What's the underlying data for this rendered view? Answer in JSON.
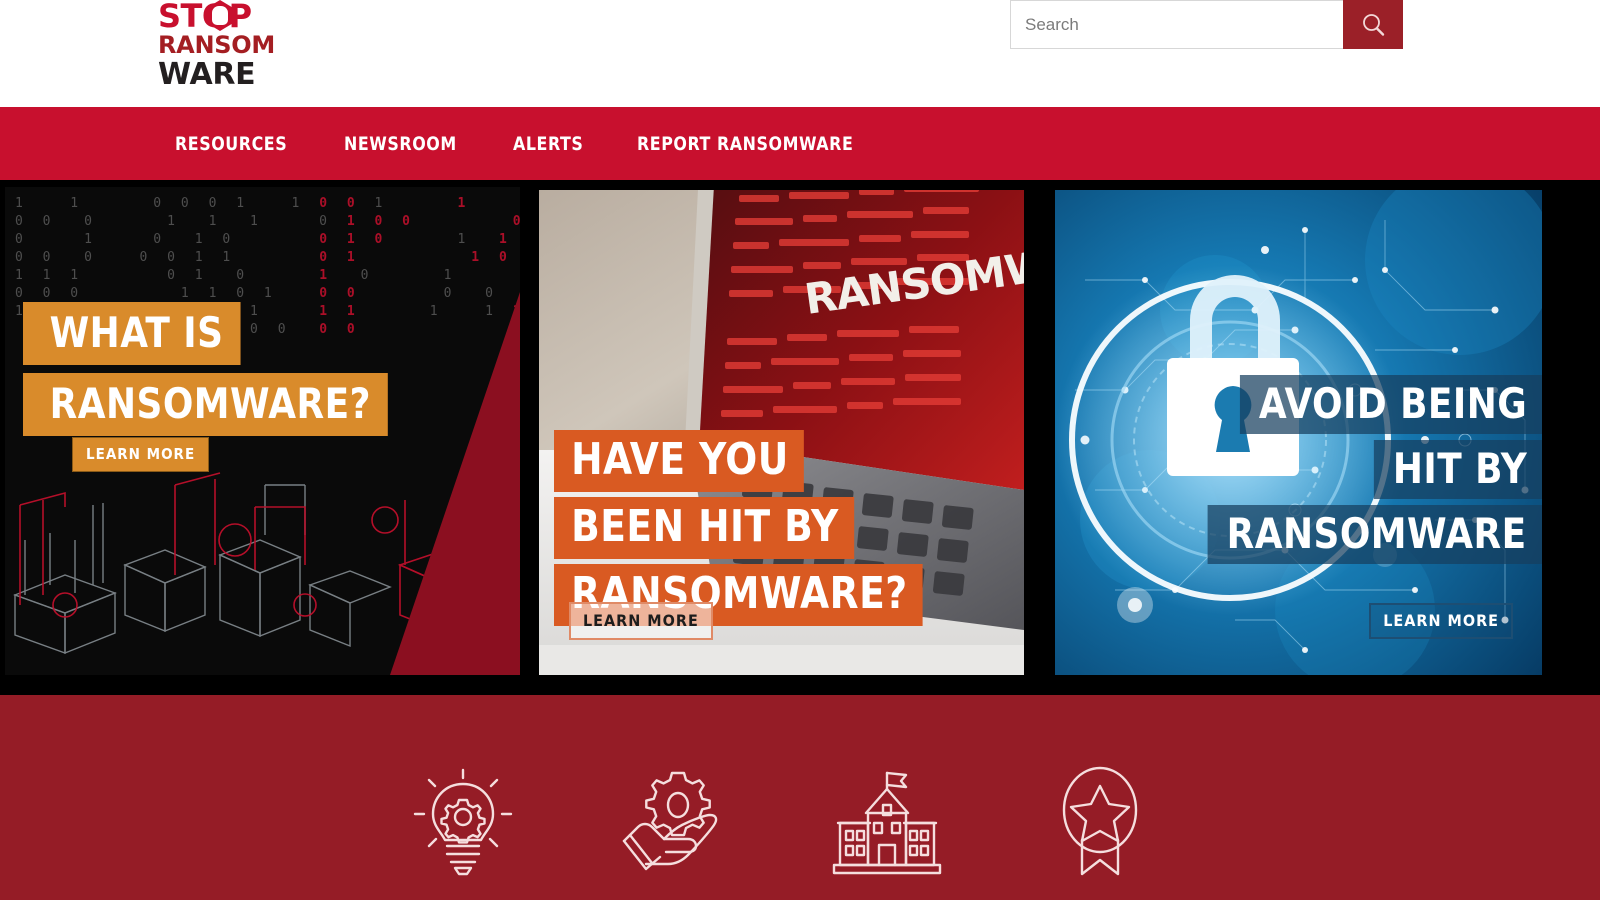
{
  "site": {
    "logo": {
      "line1": "STOP",
      "line2": "RANSOM",
      "line3": "WARE",
      "icon": "shield-bug-icon"
    },
    "colors": {
      "nav_red": "#C8102E",
      "dark_red": "#951C26",
      "search_button_red": "#9B2028",
      "card1_accent_orange": "#D98B2B",
      "card2_accent_orange": "#D95A22",
      "card3_accent_blue": "#163E5E"
    }
  },
  "search": {
    "placeholder": "Search",
    "value": "",
    "button_icon": "search-icon"
  },
  "nav": {
    "items": [
      {
        "label": "RESOURCES"
      },
      {
        "label": "NEWSROOM"
      },
      {
        "label": "ALERTS"
      },
      {
        "label": "REPORT RANSOMWARE"
      }
    ]
  },
  "cards": [
    {
      "id": "what-is-ransomware",
      "headline_lines": [
        "WHAT IS",
        "RANSOMWARE?"
      ],
      "cta": "LEARN MORE",
      "image_alt": "dark binary code over red and gray isometric city illustration"
    },
    {
      "id": "have-you-been-hit",
      "headline_lines": [
        "HAVE YOU",
        "BEEN HIT BY",
        "RANSOMWARE?"
      ],
      "cta": "LEARN MORE",
      "image_alt": "laptop keyboard with red ransomware code on screen",
      "screen_text": "RANSOMWARE"
    },
    {
      "id": "avoid-being-hit",
      "headline_lines": [
        "AVOID BEING",
        "HIT BY",
        "RANSOMWARE"
      ],
      "cta": "LEARN MORE",
      "image_alt": "blue circuit network with glowing padlock"
    }
  ],
  "icon_band": {
    "icons": [
      {
        "name": "lightbulb-gear-icon"
      },
      {
        "name": "hand-holding-gear-icon"
      },
      {
        "name": "government-building-icon"
      },
      {
        "name": "award-ribbon-star-icon"
      }
    ]
  }
}
